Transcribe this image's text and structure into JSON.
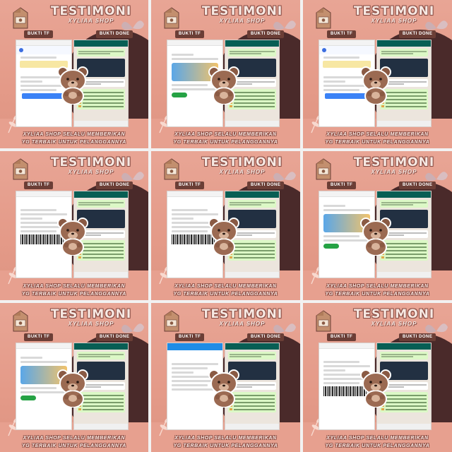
{
  "tiles": [
    {
      "title": "TESTIMONI",
      "subtitle": "XYLIAA SHOP",
      "tag_tf": "BUKTI TF",
      "tag_done": "BUKTI DONE",
      "left_variant": "pay",
      "footer_line1": "XYLIAA SHOP SELALU MEMBERIKAN",
      "footer_line2": "YG TERBAIK UNTUK PELANGGANNYA"
    },
    {
      "title": "TESTIMONI",
      "subtitle": "XYLIAA SHOP",
      "tag_tf": "BUKTI TF",
      "tag_done": "BUKTI DONE",
      "left_variant": "illus",
      "footer_line1": "XYLIAA SHOP SELALU MEMBERIKAN",
      "footer_line2": "YG TERBAIK UNTUK PELANGGANNYA"
    },
    {
      "title": "TESTIMONI",
      "subtitle": "XYLIAA SHOP",
      "tag_tf": "BUKTI TF",
      "tag_done": "BUKTI DONE",
      "left_variant": "pay",
      "footer_line1": "XYLIAA SHOP SELALU MEMBERIKAN",
      "footer_line2": "YG TERBAIK UNTUK PELANGGANNYA"
    },
    {
      "title": "TESTIMONI",
      "subtitle": "XYLIAA SHOP",
      "tag_tf": "BUKTI TF",
      "tag_done": "BUKTI DONE",
      "left_variant": "qris",
      "footer_line1": "XYLIAA SHOP SELALU MEMBERIKAN",
      "footer_line2": "YG TERBAIK UNTUK PELANGGANNYA"
    },
    {
      "title": "TESTIMONI",
      "subtitle": "XYLIAA SHOP",
      "tag_tf": "BUKTI TF",
      "tag_done": "BUKTI DONE",
      "left_variant": "qris",
      "footer_line1": "XYLIAA SHOP SELALU MEMBERIKAN",
      "footer_line2": "YG TERBAIK UNTUK PELANGGANNYA"
    },
    {
      "title": "TESTIMONI",
      "subtitle": "XYLIAA SHOP",
      "tag_tf": "BUKTI TF",
      "tag_done": "BUKTI DONE",
      "left_variant": "illus",
      "footer_line1": "XYLIAA SHOP SELALU MEMBERIKAN",
      "footer_line2": "YG TERBAIK UNTUK PELANGGANNYA"
    },
    {
      "title": "TESTIMONI",
      "subtitle": "XYLIAA SHOP",
      "tag_tf": "BUKTI TF",
      "tag_done": "BUKTI DONE",
      "left_variant": "illus",
      "footer_line1": "XYLIAA SHOP SELALU MEMBERIKAN",
      "footer_line2": "YG TERBAIK UNTUK PELANGGANNYA"
    },
    {
      "title": "TESTIMONI",
      "subtitle": "XYLIAA SHOP",
      "tag_tf": "BUKTI TF",
      "tag_done": "BUKTI DONE",
      "left_variant": "dana",
      "footer_line1": "XYLIAA SHOP SELALU MEMBERIKAN",
      "footer_line2": "YG TERBAIK UNTUK PELANGGANNYA"
    },
    {
      "title": "TESTIMONI",
      "subtitle": "XYLIAA SHOP",
      "tag_tf": "BUKTI TF",
      "tag_done": "BUKTI DONE",
      "left_variant": "qris",
      "footer_line1": "XYLIAA SHOP SELALU MEMBERIKAN",
      "footer_line2": "YG TERBAIK UNTUK PELANGGANNYA"
    }
  ],
  "colors": {
    "background": "#e49a88",
    "dark_wave": "#4a2a2a",
    "title_text": "#f7e9e3",
    "outline": "#8a4e45",
    "tag_bg": "#6b3e36"
  },
  "icons": [
    "milk-carton-icon",
    "bear-sticker",
    "flower-sprig-icon",
    "butterfly-icon"
  ]
}
